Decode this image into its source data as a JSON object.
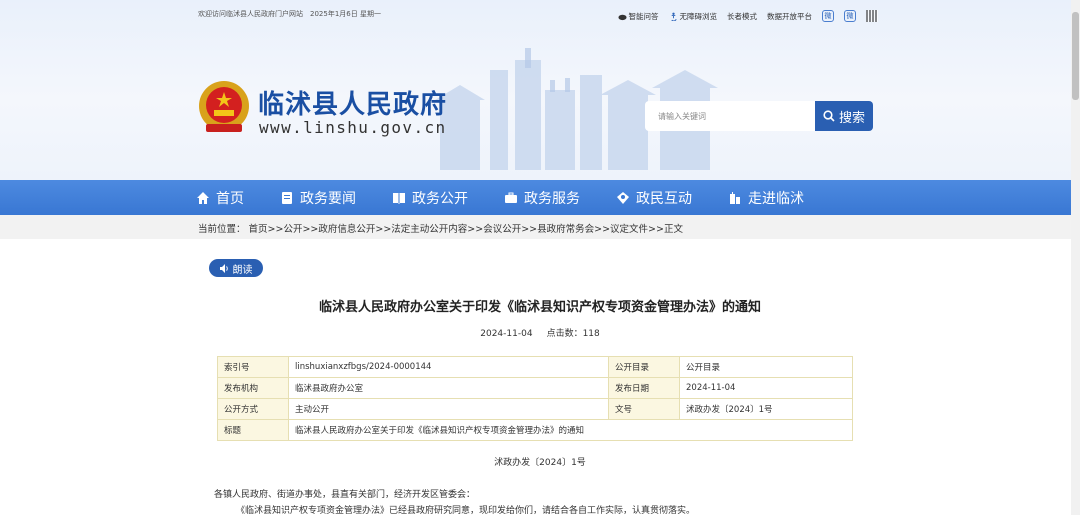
{
  "topbar": {
    "welcome": "欢迎访问临沭县人民政府门户网站",
    "date": "2025年1月6日 星期一",
    "links": [
      "智能问答",
      "无障碍浏览",
      "长者模式",
      "数据开放平台"
    ],
    "wechat_badge": "微",
    "weibo_badge": "微"
  },
  "site": {
    "name": "临沭县人民政府",
    "url": "www.linshu.gov.cn"
  },
  "search": {
    "placeholder": "请输入关键词",
    "button_label": "搜索"
  },
  "nav": {
    "items": [
      "首页",
      "政务要闻",
      "政务公开",
      "政务服务",
      "政民互动",
      "走进临沭"
    ]
  },
  "breadcrumb": {
    "text": "当前位置：  首页>>公开>>政府信息公开>>法定主动公开内容>>会议公开>>县政府常务会>>议定文件>>正文"
  },
  "article": {
    "read_label": "朗读",
    "title": "临沭县人民政府办公室关于印发《临沭县知识产权专项资金管理办法》的通知",
    "date": "2024-11-04",
    "clicks": "点击数：118",
    "info": {
      "index_label": "索引号",
      "index_value": "linshuxianxzfbgs/2024-0000144",
      "catalog_label": "公开目录",
      "catalog_value": "公开目录",
      "publisher_label": "发布机构",
      "publisher_value": "临沭县政府办公室",
      "pubdate_label": "发布日期",
      "pubdate_value": "2024-11-04",
      "mode_label": "公开方式",
      "mode_value": "主动公开",
      "docno_label": "文号",
      "docno_value": "沭政办发〔2024〕1号",
      "subject_label": "标题",
      "subject_value": "临沭县人民政府办公室关于印发《临沭县知识产权专项资金管理办法》的通知"
    },
    "doc_number": "沭政办发〔2024〕1号",
    "para1": "各镇人民政府、街道办事处，县直有关部门，经济开发区管委会：",
    "para2": "《临沭县知识产权专项资金管理办法》已经县政府研究同意，现印发给你们，请结合各自工作实际，认真贯彻落实。"
  },
  "colors": {
    "brand_blue": "#2a5fb2",
    "nav_blue": "#3977d3",
    "table_border": "#e6dfb2",
    "table_key_bg": "#fbf7e1"
  }
}
